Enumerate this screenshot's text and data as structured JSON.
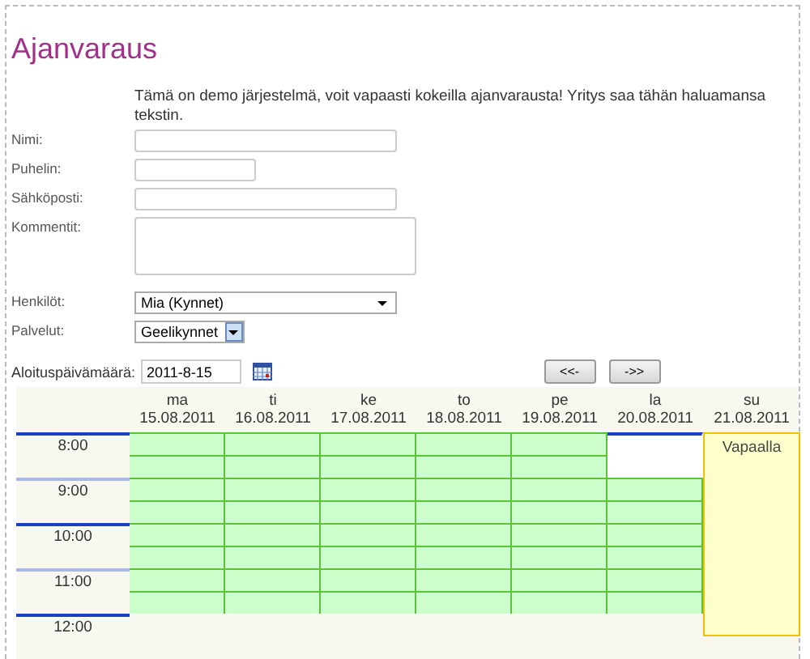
{
  "title": "Ajanvaraus",
  "intro": "Tämä on demo järjestelmä, voit vapaasti kokeilla ajanvarausta! Yritys saa tähän haluamansa tekstin.",
  "fields": [
    {
      "label": "Nimi:",
      "kind": "text"
    },
    {
      "label": "Puhelin:",
      "kind": "text"
    },
    {
      "label": "Sähköposti:",
      "kind": "text"
    },
    {
      "label": "Kommentit:",
      "kind": "textarea"
    },
    {
      "label": "Henkilöt:",
      "kind": "select",
      "value": "Mia (Kynnet)"
    },
    {
      "label": "Palvelut:",
      "kind": "combo",
      "value": "Geelikynnet"
    }
  ],
  "start_date": {
    "label": "Aloituspäivämäärä:",
    "value": "2011-8-15"
  },
  "nav_buttons": [
    "<<-",
    "->>"
  ],
  "times": [
    "8:00",
    "9:00",
    "10:00",
    "11:00",
    "12:00"
  ],
  "days": [
    {
      "name": "ma",
      "date": "15.08.2011",
      "kind": "slots",
      "slots": [
        {
          "available": true
        },
        {
          "available": true
        },
        {
          "available": true
        },
        {
          "available": true
        },
        {
          "available": true
        },
        {
          "available": true
        },
        {
          "available": true
        },
        {
          "available": true
        }
      ]
    },
    {
      "name": "ti",
      "date": "16.08.2011",
      "kind": "slots",
      "slots": [
        {
          "available": true
        },
        {
          "available": true
        },
        {
          "available": true
        },
        {
          "available": true
        },
        {
          "available": true
        },
        {
          "available": true
        },
        {
          "available": true
        },
        {
          "available": true
        }
      ]
    },
    {
      "name": "ke",
      "date": "17.08.2011",
      "kind": "slots",
      "slots": [
        {
          "available": true
        },
        {
          "available": true
        },
        {
          "available": true
        },
        {
          "available": true
        },
        {
          "available": true
        },
        {
          "available": true
        },
        {
          "available": true
        },
        {
          "available": true
        }
      ]
    },
    {
      "name": "to",
      "date": "18.08.2011",
      "kind": "slots",
      "slots": [
        {
          "available": true
        },
        {
          "available": true
        },
        {
          "available": true
        },
        {
          "available": true
        },
        {
          "available": true
        },
        {
          "available": true
        },
        {
          "available": true
        },
        {
          "available": true
        }
      ]
    },
    {
      "name": "pe",
      "date": "19.08.2011",
      "kind": "slots",
      "slots": [
        {
          "available": true
        },
        {
          "available": true
        },
        {
          "available": true
        },
        {
          "available": true
        },
        {
          "available": true
        },
        {
          "available": true
        },
        {
          "available": true
        },
        {
          "available": true
        }
      ]
    },
    {
      "name": "la",
      "date": "20.08.2011",
      "kind": "slots",
      "slots": [
        {
          "available": false
        },
        {
          "available": false
        },
        {
          "available": true
        },
        {
          "available": true
        },
        {
          "available": true
        },
        {
          "available": true
        },
        {
          "available": true
        },
        {
          "available": true
        }
      ]
    },
    {
      "name": "su",
      "date": "21.08.2011",
      "kind": "off",
      "note": "Vapaalla"
    }
  ]
}
